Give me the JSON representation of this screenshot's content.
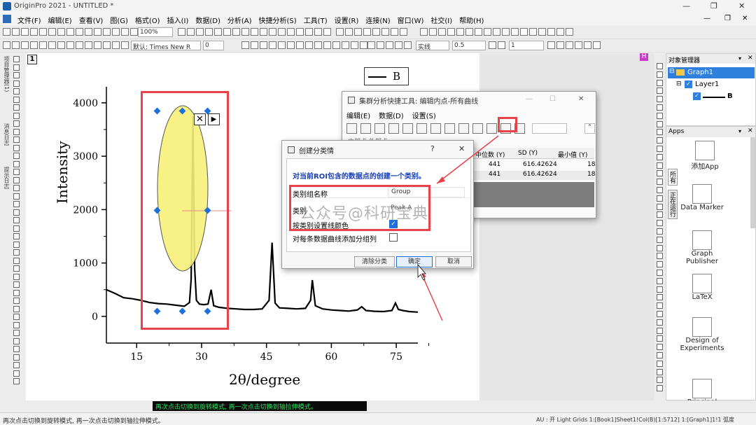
{
  "app": {
    "title": "OriginPro 2021 - UNTITLED *"
  },
  "menubar": [
    "文件(F)",
    "编辑(E)",
    "查看(V)",
    "图(G)",
    "格式(O)",
    "插入(I)",
    "数据(D)",
    "分析(A)",
    "快捷分析(S)",
    "工具(T)",
    "设置(R)",
    "连接(N)",
    "窗口(W)",
    "社交(I)",
    "帮助(H)"
  ],
  "toolbar": {
    "zoom": "100%",
    "font_name": "默认: Times New R",
    "font_size": "0",
    "line_style": "实线",
    "line_width": "0.5",
    "line_count": "1"
  },
  "graph": {
    "window_number": "1",
    "layer_badge": "H",
    "legend_label": "B",
    "xlabel": "2θ/degree",
    "ylabel": "Intensity",
    "x_ticks": [
      "15",
      "30",
      "45",
      "60",
      "75"
    ],
    "y_ticks": [
      "0",
      "1000",
      "2000",
      "3000",
      "4000"
    ]
  },
  "chart_data": {
    "type": "line",
    "title": "",
    "xlabel": "2θ/degree",
    "ylabel": "Intensity",
    "xlim": [
      8,
      80
    ],
    "ylim": [
      -500,
      4300
    ],
    "series": [
      {
        "name": "B",
        "x": [
          8,
          10,
          12,
          14,
          16,
          18,
          20,
          22,
          24,
          26,
          27.2,
          27.6,
          28,
          28.4,
          28.8,
          29.5,
          30.5,
          31.5,
          32.2,
          32.8,
          34,
          36,
          38,
          40,
          42,
          44,
          45.6,
          46.3,
          47,
          48,
          50,
          52,
          54,
          55.2,
          55.6,
          56.3,
          58,
          60,
          62,
          64,
          66,
          67,
          68,
          70,
          72,
          74,
          74.8,
          75.5,
          76.5,
          78,
          80
        ],
        "y": [
          500,
          430,
          350,
          330,
          300,
          260,
          240,
          230,
          210,
          190,
          260,
          700,
          3750,
          900,
          300,
          230,
          220,
          230,
          500,
          200,
          170,
          150,
          140,
          130,
          130,
          140,
          300,
          1380,
          250,
          160,
          150,
          140,
          150,
          300,
          680,
          200,
          140,
          120,
          110,
          100,
          120,
          180,
          110,
          95,
          90,
          110,
          250,
          130,
          110,
          90,
          80
        ]
      }
    ]
  },
  "roi": {
    "icons": [
      "close-icon",
      "play-icon"
    ]
  },
  "cluster_window": {
    "title": "集群分析快捷工具: 编辑内点-所有曲线",
    "menus": [
      "编辑(E)",
      "数据(D)",
      "设置(S)"
    ],
    "section": "内部点 外部点",
    "columns": [
      "中位数 (Y)",
      "SD (Y)",
      "最小值 (Y)"
    ],
    "rows": [
      [
        "441",
        "616.42624",
        "18"
      ],
      [
        "441",
        "616.42624",
        "18"
      ]
    ],
    "collapse_icon": "double-chevron-up-icon"
  },
  "create_dialog": {
    "title": "创建分类情",
    "help": "?",
    "description": "对当前ROI包含的数据点的创建一个类别。",
    "fields": [
      {
        "label": "类别组名称",
        "value": "Group"
      },
      {
        "label": "类别",
        "value": "Peak A"
      }
    ],
    "checkbox_color": {
      "label": "按类别设置线颜色",
      "checked": true
    },
    "checkbox_column": {
      "label": "对每条数据曲线添加分组列",
      "checked": false
    },
    "buttons": {
      "clear": "清除分类",
      "ok": "确定",
      "cancel": "取消"
    }
  },
  "watermark": "公众号@科研宝典",
  "object_manager": {
    "title": "对象管理器",
    "graph": "Graph1",
    "layer": "Layer1",
    "plot": "B"
  },
  "apps": {
    "title": "Apps",
    "tabs": [
      "所有",
      "正在运行"
    ],
    "items": [
      "添加App",
      "Data Marker",
      "Graph Publisher",
      "LaTeX",
      "Design of Experiments",
      "Principal Compone..."
    ]
  },
  "left_vertical_tabs": [
    "项目管理器(1)",
    "消息日志",
    "提示日志"
  ],
  "status": {
    "hint_green": "再次点击切换到旋转模式, 再一次点击切换到轴拉伸模式。",
    "bottom_left": "再次点击切换到旋转模式, 再一次点击切换到轴拉伸模式。",
    "bottom_right": "AU : 开  Light Grids 1:[Book1]Sheet1!Col(B)[1:5712]  1:[Graph1]1!1 弧度"
  },
  "colors": {
    "roi_ellipse": "#f7f07a",
    "highlight_red": "#e8434b",
    "accent_blue": "#1e6fd9",
    "dialog_blue": "#1a3fb5"
  }
}
